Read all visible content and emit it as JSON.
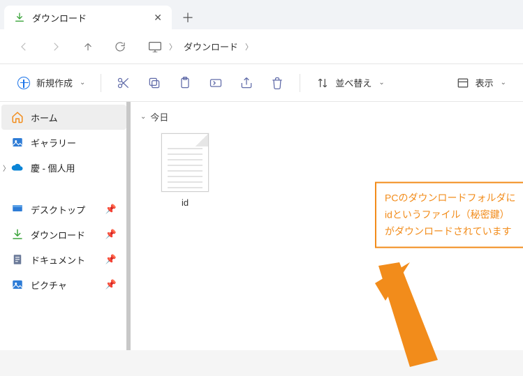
{
  "tab": {
    "title": "ダウンロード"
  },
  "breadcrumb": {
    "item1": "ダウンロード"
  },
  "toolbar": {
    "new_label": "新規作成",
    "sort_label": "並べ替え",
    "view_label": "表示"
  },
  "sidebar": {
    "home": "ホーム",
    "gallery": "ギャラリー",
    "onedrive": "慶 - 個人用",
    "desktop": "デスクトップ",
    "downloads": "ダウンロード",
    "documents": "ドキュメント",
    "pictures": "ピクチャ"
  },
  "content": {
    "group_today": "今日",
    "file_name": "id"
  },
  "annotation": {
    "line1": "PCのダウンロードフォルダに",
    "line2": "idというファイル（秘密鍵）",
    "line3": "がダウンロードされています"
  }
}
